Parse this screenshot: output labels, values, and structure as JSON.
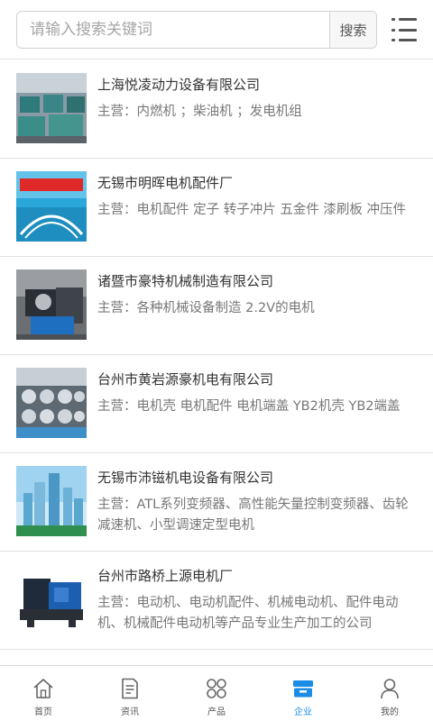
{
  "search": {
    "placeholder": "请输入搜索关键词",
    "button_label": "搜索"
  },
  "companies": [
    {
      "name": "上海悦凌动力设备有限公司",
      "main": "主营：内燃机 ；柴油机 ；发电机组",
      "thumb": "generator-workshop"
    },
    {
      "name": "无锡市明晖电机配件厂",
      "main": "主营：电机配件 定子 转子冲片 五金件 漆刷板 冲压件",
      "thumb": "factory-banner"
    },
    {
      "name": "诸暨市豪特机械制造有限公司",
      "main": "主营：各种机械设备制造 2.2V的电机",
      "thumb": "machine-workshop"
    },
    {
      "name": "台州市黄岩源豪机电有限公司",
      "main": "主营：电机壳 电机配件 电机端盖 YB2机壳 YB2端盖",
      "thumb": "motor-parts"
    },
    {
      "name": "无锡市沛镃机电设备有限公司",
      "main": "主营：ATL系列变频器、高性能矢量控制变频器、齿轮减速机、小型调速定型电机",
      "thumb": "city-skyline"
    },
    {
      "name": "台州市路桥上源电机厂",
      "main": "主营：电动机、电动机配件、机械电动机、配件电动机、机械配件电动机等产品专业生产加工的公司",
      "thumb": "generator-set"
    }
  ],
  "tabs": [
    {
      "label": "首页",
      "icon": "home-icon",
      "active": false
    },
    {
      "label": "资讯",
      "icon": "news-icon",
      "active": false
    },
    {
      "label": "产品",
      "icon": "products-icon",
      "active": false
    },
    {
      "label": "企业",
      "icon": "enterprise-icon",
      "active": true
    },
    {
      "label": "我的",
      "icon": "user-icon",
      "active": false
    }
  ],
  "colors": {
    "accent": "#1a8ce6",
    "divider": "#e2e2e2"
  }
}
